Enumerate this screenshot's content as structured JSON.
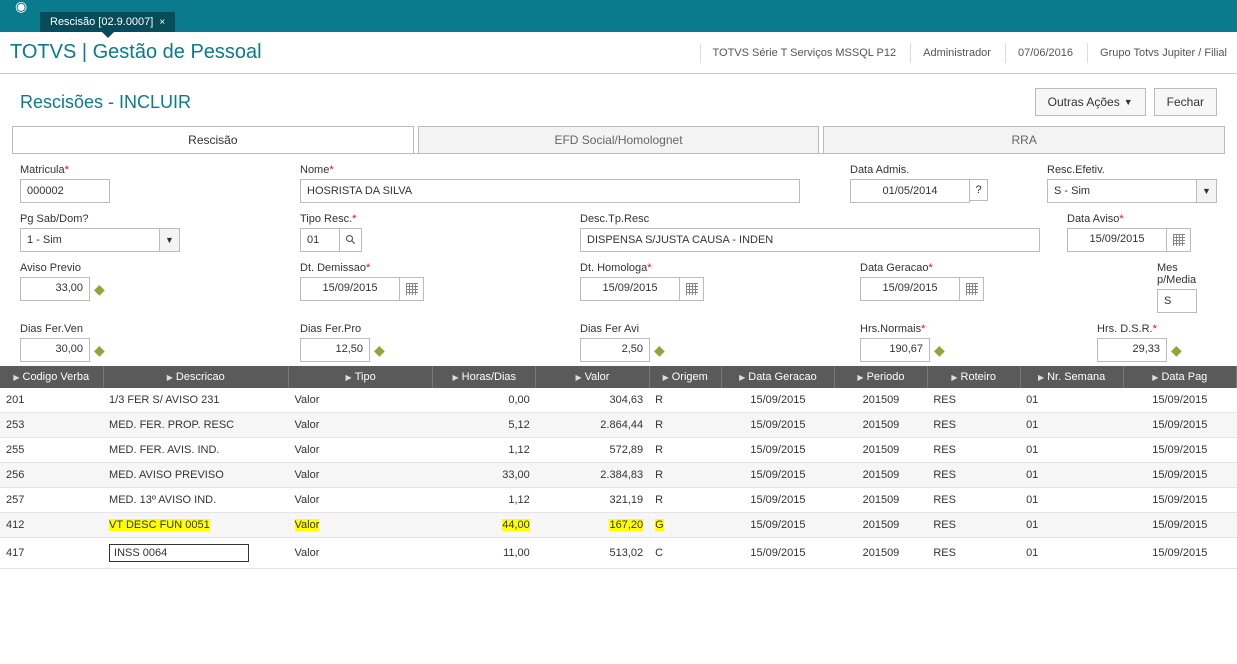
{
  "app": {
    "tab_title": "Rescisão [02.9.0007]",
    "module_title": "TOTVS | Gestão de Pessoal",
    "product": "TOTVS Série T Serviços MSSQL P12",
    "user": "Administrador",
    "date": "07/06/2016",
    "company": "Grupo Totvs Jupiter / Filial"
  },
  "page": {
    "title": "Rescisões - INCLUIR",
    "other_actions": "Outras Ações",
    "close": "Fechar"
  },
  "tabs": {
    "t1": "Rescisão",
    "t2": "EFD Social/Homolognet",
    "t3": "RRA"
  },
  "form": {
    "matricula_label": "Matricula",
    "matricula": "000002",
    "nome_label": "Nome",
    "nome": "HOSRISTA DA SILVA",
    "data_admis_label": "Data Admis.",
    "data_admis": "01/05/2014",
    "resc_efetiv_label": "Resc.Efetiv.",
    "resc_efetiv": "S - Sim",
    "pg_sab_label": "Pg Sab/Dom?",
    "pg_sab": "1 - Sim",
    "tipo_resc_label": "Tipo Resc.",
    "tipo_resc": "01",
    "desc_tp_label": "Desc.Tp.Resc",
    "desc_tp": "DISPENSA S/JUSTA CAUSA - INDEN",
    "data_aviso_label": "Data Aviso",
    "data_aviso": "15/09/2015",
    "aviso_previo_label": "Aviso Previo",
    "aviso_previo": "33,00",
    "dt_demissao_label": "Dt. Demissao",
    "dt_demissao": "15/09/2015",
    "dt_homologa_label": "Dt. Homologa",
    "dt_homologa": "15/09/2015",
    "data_geracao_label": "Data Geracao",
    "data_geracao": "15/09/2015",
    "mes_media_label": "Mes p/Media",
    "mes_media": "S",
    "dias_fer_ven_label": "Dias Fer.Ven",
    "dias_fer_ven": "30,00",
    "dias_fer_pro_label": "Dias Fer.Pro",
    "dias_fer_pro": "12,50",
    "dias_fer_avi_label": "Dias Fer Avi",
    "dias_fer_avi": "2,50",
    "hrs_normais_label": "Hrs.Normais",
    "hrs_normais": "190,67",
    "hrs_dsr_label": "Hrs. D.S.R.",
    "hrs_dsr": "29,33"
  },
  "cols": {
    "c0": "Codigo Verba",
    "c1": "Descricao",
    "c2": "Tipo",
    "c3": "Horas/Dias",
    "c4": "Valor",
    "c5": "Origem",
    "c6": "Data Geracao",
    "c7": "Periodo",
    "c8": "Roteiro",
    "c9": "Nr. Semana",
    "c10": "Data Pag"
  },
  "rows": [
    {
      "cod": "201",
      "desc": "1/3 FER S/ AVISO 231",
      "tipo": "Valor",
      "hd": "0,00",
      "valor": "304,63",
      "orig": "R",
      "dg": "15/09/2015",
      "per": "201509",
      "rot": "RES",
      "ns": "01",
      "dp": "15/09/2015",
      "alt": false,
      "hl": false,
      "box": false
    },
    {
      "cod": "253",
      "desc": "MED. FER. PROP. RESC",
      "tipo": "Valor",
      "hd": "5,12",
      "valor": "2.864,44",
      "orig": "R",
      "dg": "15/09/2015",
      "per": "201509",
      "rot": "RES",
      "ns": "01",
      "dp": "15/09/2015",
      "alt": true,
      "hl": false,
      "box": false
    },
    {
      "cod": "255",
      "desc": "MED. FER. AVIS. IND.",
      "tipo": "Valor",
      "hd": "1,12",
      "valor": "572,89",
      "orig": "R",
      "dg": "15/09/2015",
      "per": "201509",
      "rot": "RES",
      "ns": "01",
      "dp": "15/09/2015",
      "alt": false,
      "hl": false,
      "box": false
    },
    {
      "cod": "256",
      "desc": "MED. AVISO PREVISO",
      "tipo": "Valor",
      "hd": "33,00",
      "valor": "2.384,83",
      "orig": "R",
      "dg": "15/09/2015",
      "per": "201509",
      "rot": "RES",
      "ns": "01",
      "dp": "15/09/2015",
      "alt": true,
      "hl": false,
      "box": false
    },
    {
      "cod": "257",
      "desc": "MED. 13º AVISO IND.",
      "tipo": "Valor",
      "hd": "1,12",
      "valor": "321,19",
      "orig": "R",
      "dg": "15/09/2015",
      "per": "201509",
      "rot": "RES",
      "ns": "01",
      "dp": "15/09/2015",
      "alt": false,
      "hl": false,
      "box": false
    },
    {
      "cod": "412",
      "desc": "VT DESC FUN 0051",
      "tipo": "Valor",
      "hd": "44,00",
      "valor": "167,20",
      "orig": "G",
      "dg": "15/09/2015",
      "per": "201509",
      "rot": "RES",
      "ns": "01",
      "dp": "15/09/2015",
      "alt": true,
      "hl": true,
      "box": false
    },
    {
      "cod": "417",
      "desc": "INSS 0064",
      "tipo": "Valor",
      "hd": "11,00",
      "valor": "513,02",
      "orig": "C",
      "dg": "15/09/2015",
      "per": "201509",
      "rot": "RES",
      "ns": "01",
      "dp": "15/09/2015",
      "alt": false,
      "hl": false,
      "box": true
    }
  ]
}
